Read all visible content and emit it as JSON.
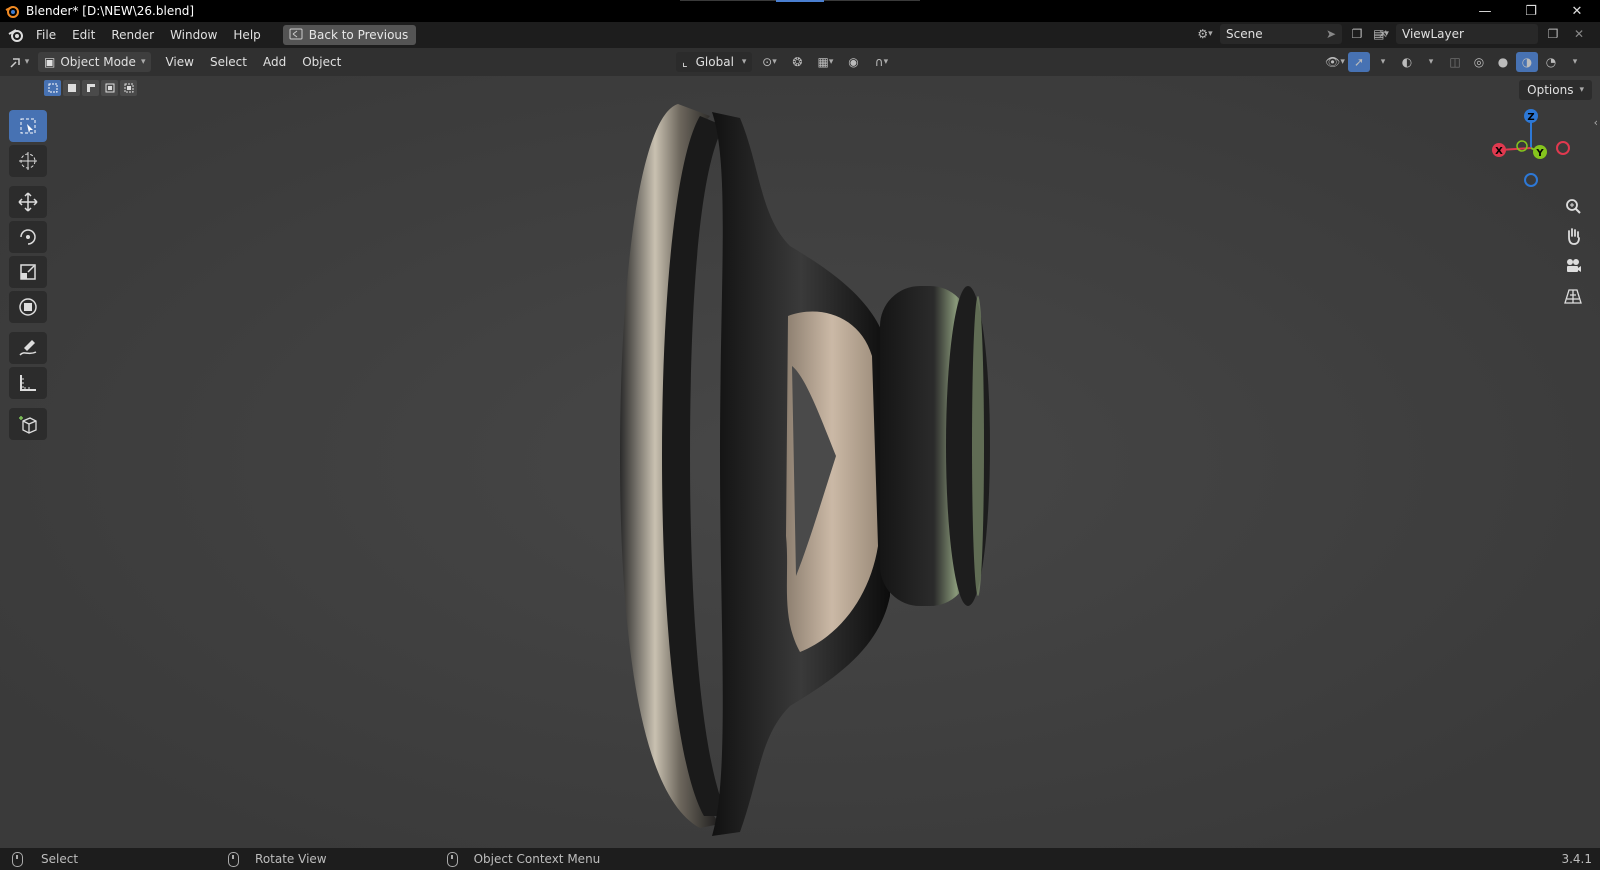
{
  "window": {
    "title": "Blender* [D:\\NEW\\26.blend]",
    "controls": [
      "minimize-icon",
      "restore-icon",
      "close-icon"
    ]
  },
  "topbar": {
    "menus": [
      "File",
      "Edit",
      "Render",
      "Window",
      "Help"
    ],
    "back_button": "Back to Previous",
    "scene_name": "Scene",
    "view_layer": "ViewLayer"
  },
  "header": {
    "mode": "Object Mode",
    "menus": [
      "View",
      "Select",
      "Add",
      "Object"
    ],
    "orientation": "Global"
  },
  "viewport": {
    "options_label": "Options",
    "gizmo": {
      "x": "X",
      "y": "Y",
      "z": "Z"
    },
    "tools": [
      "select-box-icon",
      "cursor-icon",
      "move-icon",
      "rotate-icon",
      "scale-icon",
      "transform-icon",
      "annotate-icon",
      "measure-icon",
      "add-cube-icon"
    ],
    "colors": {
      "active_tool": "#4772b3",
      "x_axis": "#e0394f",
      "y_axis": "#85c41d",
      "z_axis": "#2d78d6"
    }
  },
  "statusbar": {
    "left_click": "Select",
    "middle_click": "Rotate View",
    "right_click": "Object Context Menu",
    "version": "3.4.1"
  }
}
